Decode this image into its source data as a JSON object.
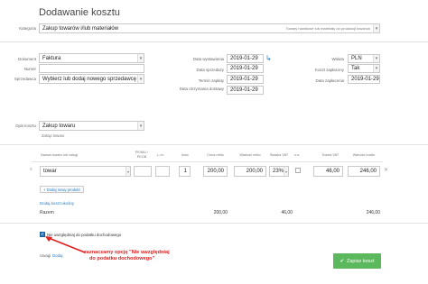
{
  "page": {
    "title": "Dodawanie kosztu"
  },
  "category": {
    "label": "Kategoria",
    "value": "Zakup towarów i/lub materiałów",
    "hint": "Towary handlowe lub materiały do produkcji towarów"
  },
  "document": {
    "label": "Dokument",
    "value": "Faktura"
  },
  "number": {
    "label": "Numer",
    "value": ""
  },
  "seller": {
    "label": "Sprzedawca",
    "value": "Wybierz lub dodaj nowego sprzedawcę"
  },
  "dates": {
    "issue": {
      "label": "Data wystawienia",
      "value": "2019-01-29"
    },
    "sale": {
      "label": "Data sprzedaży",
      "value": "2019-01-29"
    },
    "due": {
      "label": "Termin zapłaty",
      "value": "2019-01-29"
    },
    "received": {
      "label": "Data otrzymania dostawy",
      "value": "2019-01-29"
    }
  },
  "currency": {
    "label": "Waluta",
    "value": "PLN"
  },
  "paid": {
    "label": "Koszt zapłacony",
    "value": "Tak"
  },
  "paid_date": {
    "label": "Data zapłacenia",
    "value": "2019-01-29"
  },
  "cost_desc": {
    "label": "Opis kosztu",
    "value": "Zakup towaru",
    "sub": "Zakup towaru"
  },
  "table": {
    "headers": {
      "name": "Nazwa towaru lub usługi",
      "pkwiu": "PKWiU / PKOB",
      "lp": "L.m.",
      "qty": "Ilość",
      "unit_net": "Cena netto",
      "net_value": "Wartość netto",
      "vat_rate": "Stawka VAT",
      "ne": "n.o.",
      "vat_amount": "Kwota VAT",
      "gross": "Wartość brutto"
    },
    "row": {
      "name": "towar",
      "qty": "1",
      "unit_net": "200,00",
      "net_value": "200,00",
      "vat_rate": "23%",
      "vat_amount": "46,00",
      "gross": "246,00"
    },
    "add_product": "+ Dodaj nowy produkt",
    "attachment_link": "Dodaj koszt ukośny",
    "total_label": "Razem",
    "totals": {
      "net": "200,00",
      "vat": "46,00",
      "gross": "246,00"
    }
  },
  "checkbox": {
    "label": "Nie uwzględniaj do podatku dochodowego"
  },
  "annotation": {
    "line1": "zaznaczamy opcję \"Nie uwzględniaj",
    "line2": "do podatku dochodowego\""
  },
  "footer_link": {
    "prefix": "Uwagi",
    "link": "Dodaj"
  },
  "save_button": {
    "label": "Zapisz koszt"
  },
  "colors": {
    "accent": "#5cb85c",
    "link": "#2a7bc0",
    "annotation": "#e02020"
  }
}
